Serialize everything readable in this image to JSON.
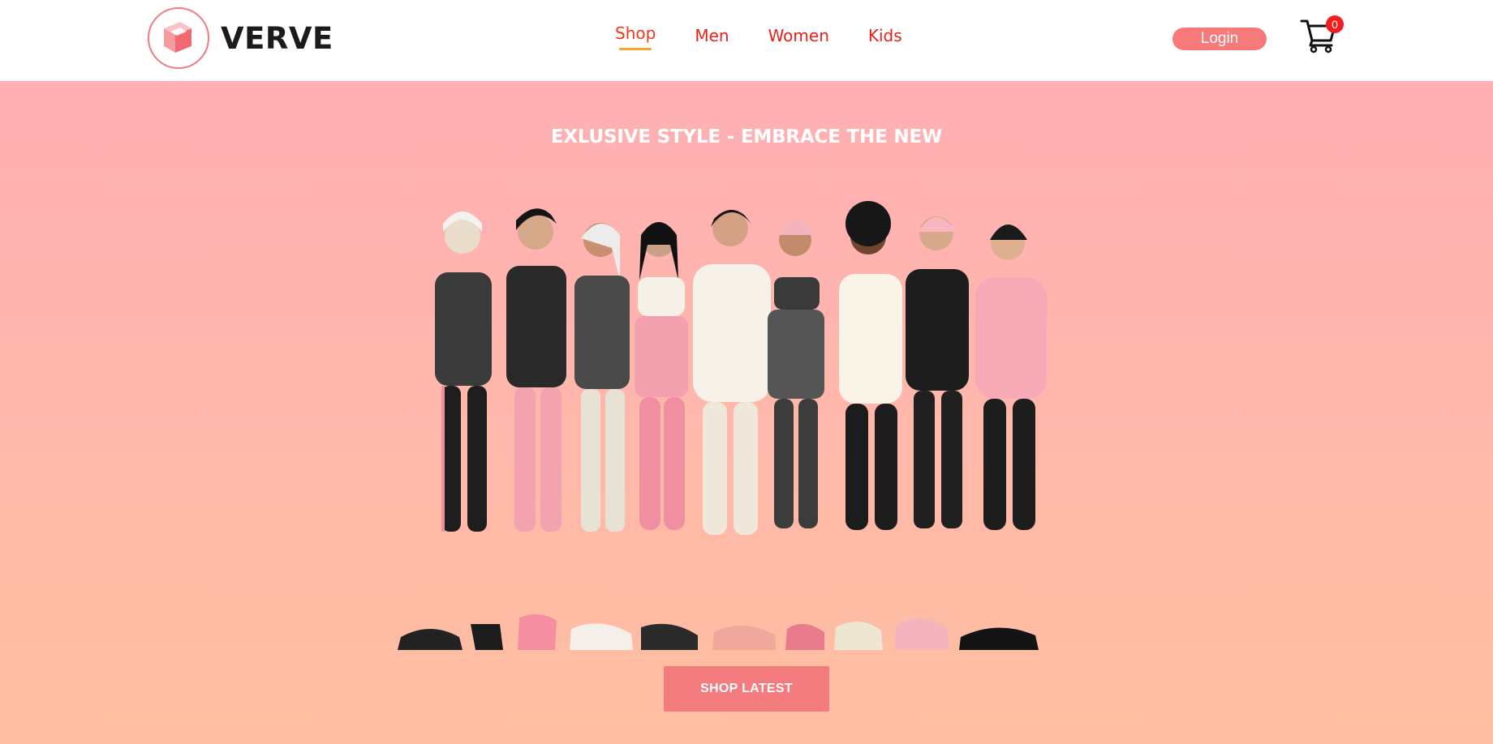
{
  "brand": {
    "name": "VERVE",
    "logo_icon": "cube-logo-icon"
  },
  "nav": {
    "items": [
      {
        "label": "Shop",
        "active": true
      },
      {
        "label": "Men",
        "active": false
      },
      {
        "label": "Women",
        "active": false
      },
      {
        "label": "Kids",
        "active": false
      }
    ]
  },
  "header": {
    "login_label": "Login",
    "cart_icon": "cart-icon",
    "cart_count": "0"
  },
  "hero": {
    "tagline": "EXLUSIVE STYLE - EMBRACE THE NEW",
    "image_icon": "fashion-group-illustration",
    "cta_label": "SHOP LATEST"
  },
  "colors": {
    "accent": "#f77979",
    "nav_text": "#e8201c",
    "nav_underline": "#f5a623",
    "hero_top": "#ffafb4",
    "hero_bottom": "#ffbfa0",
    "badge": "#f21d1d"
  }
}
